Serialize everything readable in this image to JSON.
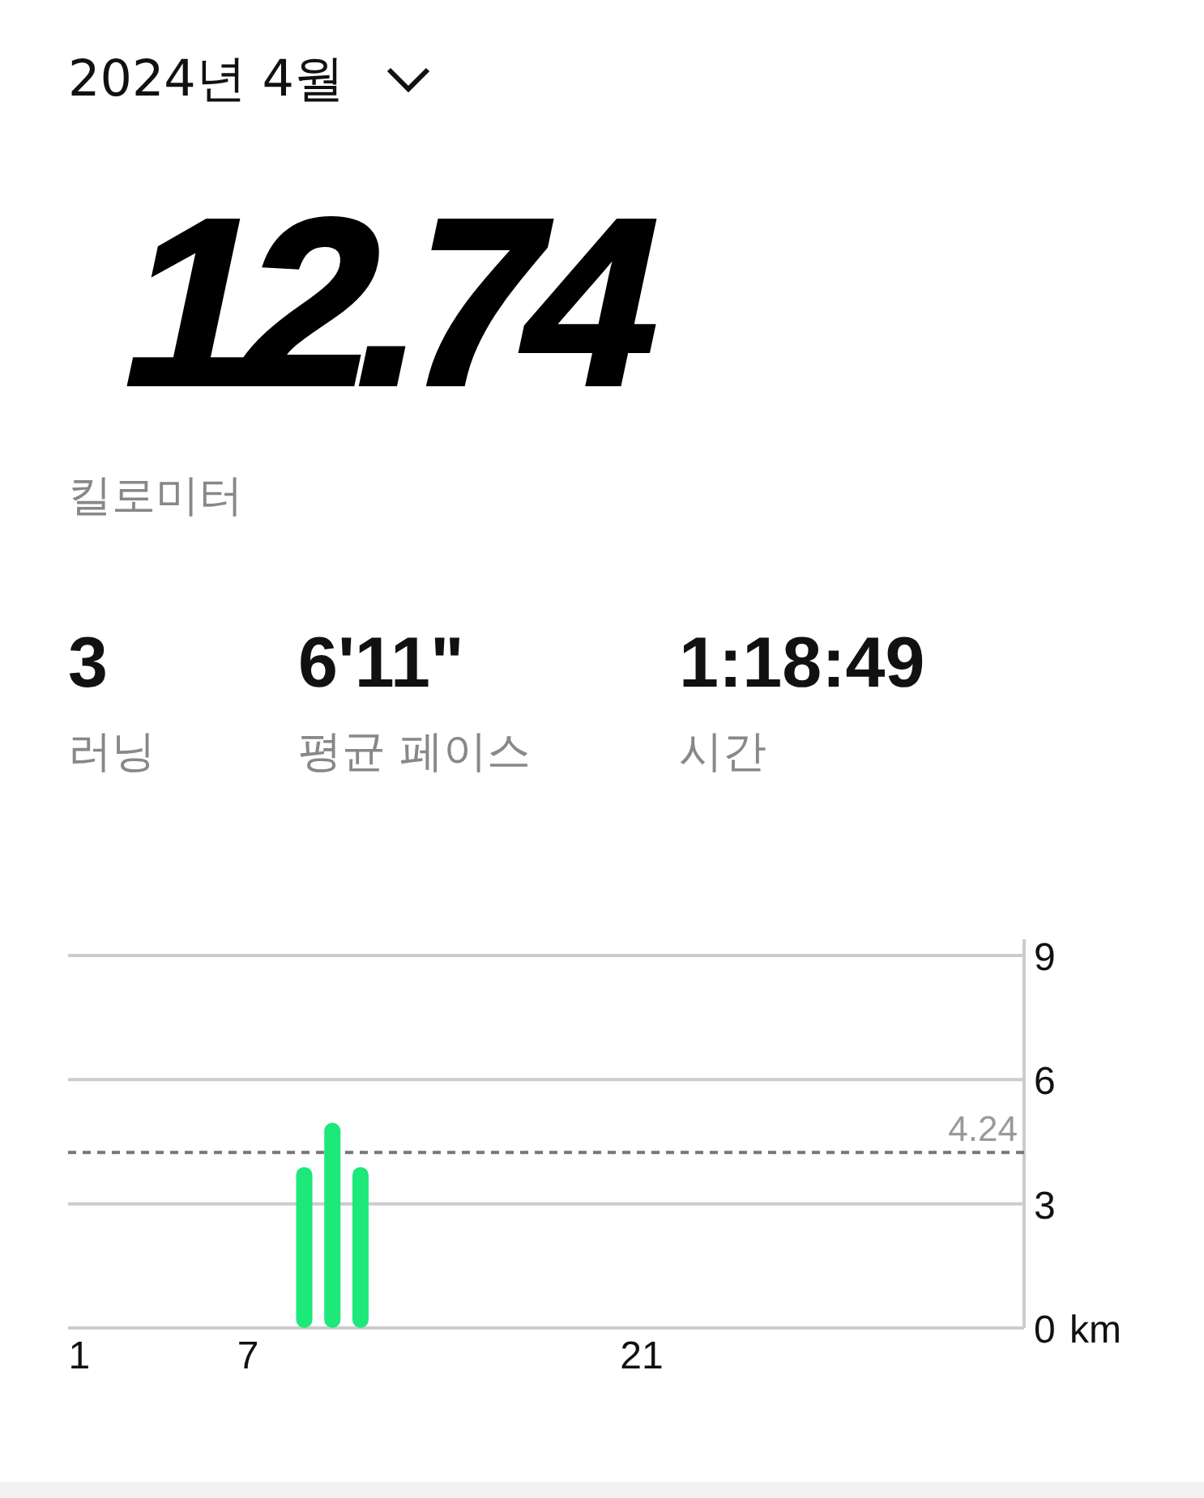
{
  "period_selector": {
    "label": "2024년 4월"
  },
  "total": {
    "value": "12.74",
    "unit": "킬로미터"
  },
  "stats": [
    {
      "value": "3",
      "label": "러닝"
    },
    {
      "value": "6'11\"",
      "label": "평균 페이스"
    },
    {
      "value": "1:18:49",
      "label": "시간"
    }
  ],
  "chart": {
    "chart_data": {
      "type": "bar",
      "x": [
        9,
        10,
        11
      ],
      "series": [
        {
          "color": "#1de87a",
          "values": [
            3.89,
            4.96,
            3.89
          ]
        }
      ],
      "xlim": [
        0.6,
        34.6
      ],
      "ylabel": "km",
      "xticks": [
        {
          "value": 1,
          "label": "1"
        },
        {
          "value": 7,
          "label": "7"
        },
        {
          "value": 21,
          "label": "21"
        }
      ],
      "ylim": [
        0,
        9
      ],
      "yticks": [
        0,
        3,
        6,
        9
      ],
      "ref_lines": [
        {
          "axis": "y",
          "value": 4.24,
          "label": "4.24"
        }
      ]
    }
  }
}
